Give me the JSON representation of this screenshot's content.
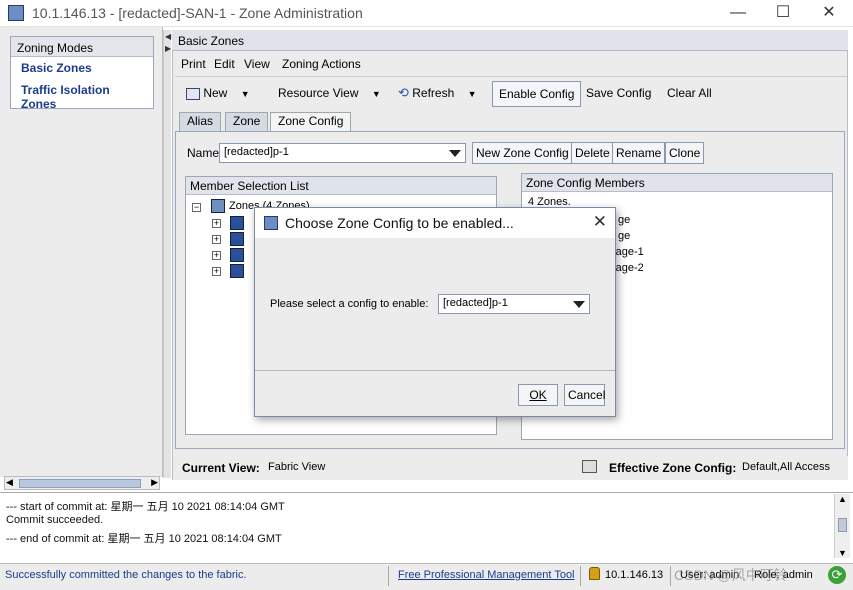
{
  "window": {
    "title": "10.1.146.13 - [redacted]-SAN-1 - Zone Administration",
    "controls": {
      "minimize": "—",
      "maximize": "☐",
      "close": "✕"
    }
  },
  "left_panel": {
    "header": "Zoning Modes",
    "items": [
      "Basic Zones",
      "Traffic Isolation Zones"
    ]
  },
  "main": {
    "header": "Basic Zones",
    "menu": [
      "Print",
      "Edit",
      "View",
      "Zoning Actions"
    ],
    "toolbar": {
      "new": "New",
      "resource_view": "Resource View",
      "refresh": "Refresh",
      "enable_config": "Enable Config",
      "save_config": "Save Config",
      "clear_all": "Clear All"
    },
    "tabs": [
      "Alias",
      "Zone",
      "Zone Config"
    ],
    "active_tab": "Zone Config",
    "name_label": "Name",
    "name_value": "[redacted]p-1",
    "buttons": {
      "new_zone_config": "New Zone Config",
      "delete": "Delete",
      "rename": "Rename",
      "clone": "Clone"
    },
    "member_list": {
      "header": "Member Selection List",
      "root": "Zones (4 Zones)",
      "child_count": 4
    },
    "config_members": {
      "header": "Zone Config Members",
      "summary": "4 Zones.",
      "items": [
        "ge",
        "ge",
        "rage-1",
        "rage-2"
      ]
    },
    "current_view_label": "Current View:",
    "current_view_value": "Fabric View",
    "effective_label": "Effective Zone Config:",
    "effective_value": "Default,All Access"
  },
  "console": {
    "lines": [
      "--- start of commit at: 星期一 五月 10 2021 08:14:04 GMT",
      "Commit succeeded.",
      "--- end of commit at: 星期一 五月 10 2021 08:14:04 GMT"
    ]
  },
  "statusbar": {
    "message": "Successfully committed the changes to the fabric.",
    "link": "Free Professional Management Tool",
    "ip": "10.1.146.13",
    "user": "User: admin",
    "role": "Role: admin",
    "watermark": "CSDN @风中叮铃"
  },
  "dialog": {
    "title": "Choose Zone Config to be enabled...",
    "prompt": "Please select a config to enable:",
    "selected": "[redacted]p-1",
    "ok": "OK",
    "cancel": "Cancel"
  },
  "colors": {
    "link": "#1b3b8c",
    "panel_bg": "#ececec",
    "header_bg": "#e1e3ea"
  }
}
